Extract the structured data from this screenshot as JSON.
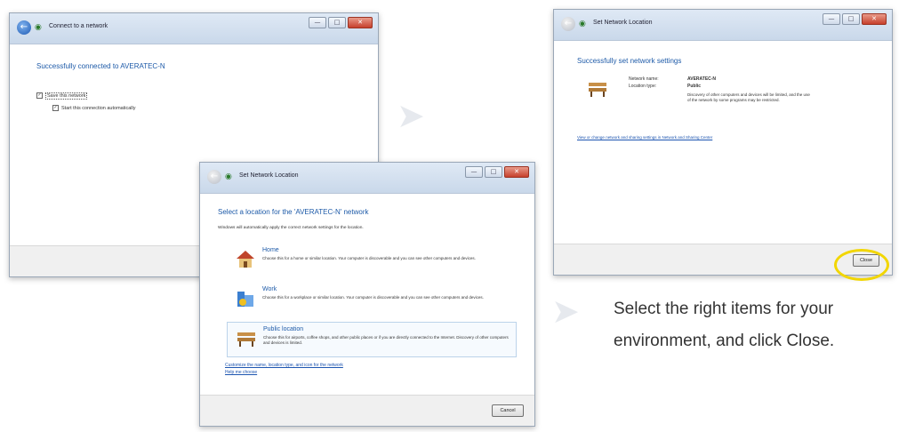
{
  "caption_buttons": {
    "min": "—",
    "max": "□",
    "close": "✕"
  },
  "window1": {
    "title": "Connect to a network",
    "headline": "Successfully connected to AVERATEC-N",
    "checkbox1": "Save this network",
    "checkbox2": "Start this connection automatically"
  },
  "window2": {
    "title": "Set Network Location",
    "headline": "Select a location for the 'AVERATEC-N' network",
    "intro": "Windows will automatically apply the correct network settings for the location.",
    "options": [
      {
        "title": "Home",
        "desc": "Choose this for a home or similar location. Your computer is discoverable and you can see other computers and devices."
      },
      {
        "title": "Work",
        "desc": "Choose this for a workplace or similar location. Your computer is discoverable and you can see other computers and devices."
      },
      {
        "title": "Public location",
        "desc": "Choose this for airports, coffee shops, and other public places or if you are directly connected to the Internet. Discovery of other computers and devices is limited."
      }
    ],
    "link1": "Customize the name, location type, and icon for the network",
    "link2": "Help me choose",
    "cancel_label": "Cancel"
  },
  "window3": {
    "title": "Set Network Location",
    "headline": "Successfully set network settings",
    "name_label": "Network name:",
    "name_value": "AVERATEC-N",
    "type_label": "Location type:",
    "type_value": "Public",
    "desc": "Discovery of other computers and devices will be limited, and the use of the network by some programs may be restricted.",
    "link": "View or change network and sharing settings in Network and Sharing Center",
    "close_label": "Close"
  },
  "instruction": {
    "line1": "Select the right items for your",
    "line2": "environment, and click Close."
  }
}
